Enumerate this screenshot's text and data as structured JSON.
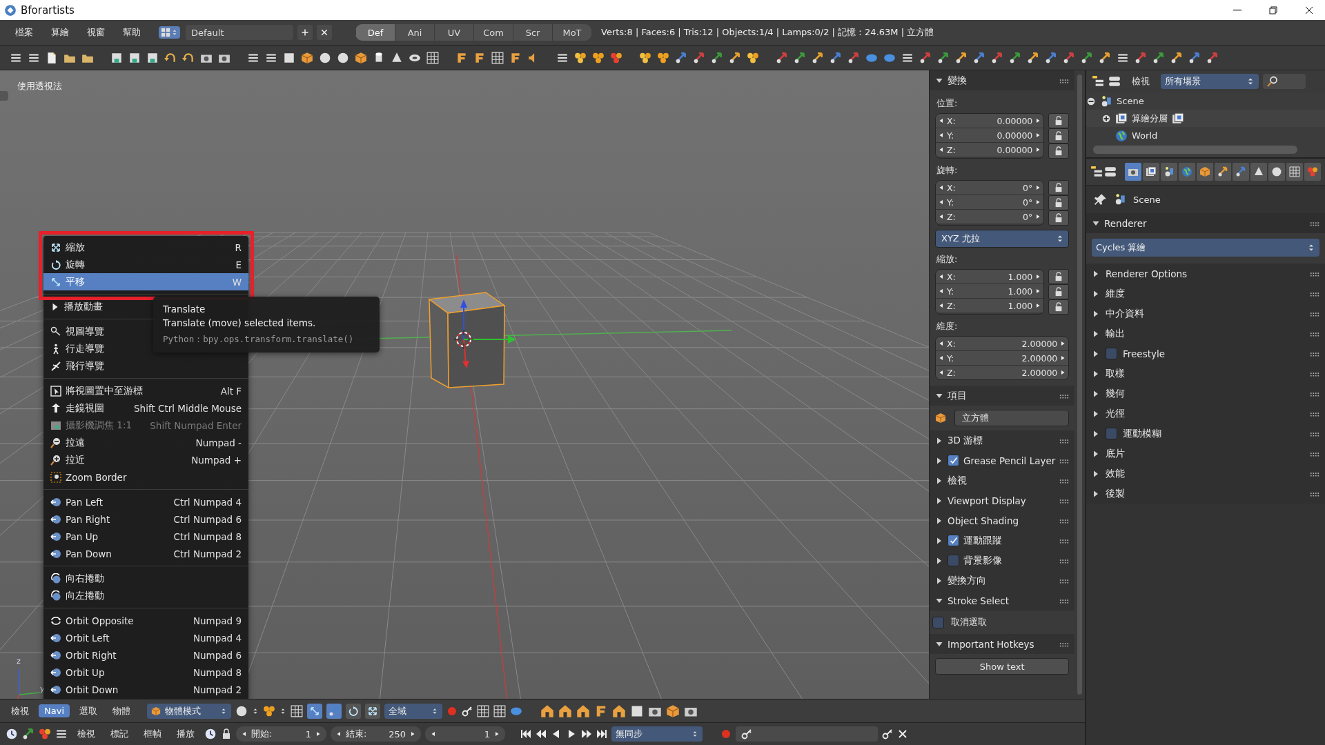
{
  "window": {
    "title": "Bforartists"
  },
  "menu_bar": [
    "檔案",
    "算繪",
    "視窗",
    "幫助"
  ],
  "layout": {
    "value": "Default"
  },
  "workspace_tabs": [
    {
      "label": "Def",
      "selected": true
    },
    {
      "label": "Ani",
      "selected": false
    },
    {
      "label": "UV",
      "selected": false
    },
    {
      "label": "Com",
      "selected": false
    },
    {
      "label": "Scr",
      "selected": false
    },
    {
      "label": "MoT",
      "selected": false
    }
  ],
  "stats": "Verts:8 | Faces:6 | Tris:12 | Objects:1/4 | Lamps:0/2 | 記憶：24.63M | 立方體",
  "viewport": {
    "label": "使用透視法",
    "axis_labels": [
      "z",
      "y"
    ]
  },
  "view_menu": {
    "sections": [
      [
        {
          "label": "縮放",
          "shortcut": "R",
          "kind": "command",
          "selected": false,
          "disabled": false
        },
        {
          "label": "旋轉",
          "shortcut": "E",
          "kind": "command",
          "selected": false,
          "disabled": false
        },
        {
          "label": "平移",
          "shortcut": "W",
          "kind": "command",
          "selected": true,
          "disabled": false
        }
      ],
      [
        {
          "label": "播放動畫",
          "kind": "submenu",
          "selected": false,
          "disabled": false
        }
      ],
      [
        {
          "label": "視圖導覽",
          "kind": "command",
          "selected": false,
          "disabled": false
        },
        {
          "label": "行走導覽",
          "kind": "command",
          "selected": false,
          "disabled": false
        },
        {
          "label": "飛行導覽",
          "kind": "command",
          "selected": false,
          "disabled": false
        }
      ],
      [
        {
          "label": "將視圖置中至游標",
          "shortcut": "Alt F",
          "kind": "command",
          "selected": false,
          "disabled": false
        },
        {
          "label": "走鏡視圖",
          "shortcut": "Shift Ctrl Middle Mouse",
          "kind": "command",
          "selected": false,
          "disabled": false
        },
        {
          "label": "攝影機調焦 1:1",
          "shortcut": "Shift Numpad Enter",
          "kind": "command",
          "selected": false,
          "disabled": true
        },
        {
          "label": "拉遠",
          "shortcut": "Numpad -",
          "kind": "command",
          "selected": false,
          "disabled": false
        },
        {
          "label": "拉近",
          "shortcut": "Numpad +",
          "kind": "command",
          "selected": false,
          "disabled": false
        },
        {
          "label": "Zoom Border",
          "kind": "command",
          "selected": false,
          "disabled": false
        }
      ],
      [
        {
          "label": "Pan Left",
          "shortcut": "Ctrl Numpad 4",
          "kind": "command",
          "selected": false,
          "disabled": false
        },
        {
          "label": "Pan Right",
          "shortcut": "Ctrl Numpad 6",
          "kind": "command",
          "selected": false,
          "disabled": false
        },
        {
          "label": "Pan Up",
          "shortcut": "Ctrl Numpad 8",
          "kind": "command",
          "selected": false,
          "disabled": false
        },
        {
          "label": "Pan Down",
          "shortcut": "Ctrl Numpad 2",
          "kind": "command",
          "selected": false,
          "disabled": false
        }
      ],
      [
        {
          "label": "向右捲動",
          "kind": "command",
          "selected": false,
          "disabled": false
        },
        {
          "label": "向左捲動",
          "kind": "command",
          "selected": false,
          "disabled": false
        }
      ],
      [
        {
          "label": "Orbit Opposite",
          "shortcut": "Numpad 9",
          "kind": "command",
          "selected": false,
          "disabled": false
        },
        {
          "label": "Orbit Left",
          "shortcut": "Numpad 4",
          "kind": "command",
          "selected": false,
          "disabled": false
        },
        {
          "label": "Orbit Right",
          "shortcut": "Numpad 6",
          "kind": "command",
          "selected": false,
          "disabled": false
        },
        {
          "label": "Orbit Up",
          "shortcut": "Numpad 8",
          "kind": "command",
          "selected": false,
          "disabled": false
        },
        {
          "label": "Orbit Down",
          "shortcut": "Numpad 2",
          "kind": "command",
          "selected": false,
          "disabled": false
        }
      ]
    ]
  },
  "tooltip": {
    "title": "Translate",
    "description": "Translate (move) selected items.",
    "python": "Python：bpy.ops.transform.translate()"
  },
  "n_panel": {
    "transform": {
      "title": "變換",
      "expanded": true,
      "rows": [
        {
          "kind": "vector",
          "label": "位置:",
          "locks": true,
          "fields": [
            {
              "axis": "X:",
              "value": "0.00000"
            },
            {
              "axis": "Y:",
              "value": "0.00000"
            },
            {
              "axis": "Z:",
              "value": "0.00000"
            }
          ]
        },
        {
          "kind": "vector",
          "label": "旋轉:",
          "locks": true,
          "fields": [
            {
              "axis": "X:",
              "value": "0°"
            },
            {
              "axis": "Y:",
              "value": "0°"
            },
            {
              "axis": "Z:",
              "value": "0°"
            }
          ]
        },
        {
          "kind": "dropdown",
          "value": "XYZ 尤拉"
        },
        {
          "kind": "vector",
          "label": "縮放:",
          "locks": true,
          "fields": [
            {
              "axis": "X:",
              "value": "1.000"
            },
            {
              "axis": "Y:",
              "value": "1.000"
            },
            {
              "axis": "Z:",
              "value": "1.000"
            }
          ]
        },
        {
          "kind": "vector",
          "label": "維度:",
          "locks": false,
          "fields": [
            {
              "axis": "X:",
              "value": "2.00000"
            },
            {
              "axis": "Y:",
              "value": "2.00000"
            },
            {
              "axis": "Z:",
              "value": "2.00000"
            }
          ]
        }
      ]
    },
    "item": {
      "title": "項目",
      "expanded": true,
      "name": "立方體"
    },
    "panels": [
      {
        "title": "3D 游標",
        "expanded": false,
        "kind": "plain"
      },
      {
        "title": "Grease Pencil Layer",
        "expanded": false,
        "kind": "toggle",
        "checked": true
      },
      {
        "title": "檢視",
        "expanded": false,
        "kind": "plain"
      },
      {
        "title": "Viewport Display",
        "expanded": false,
        "kind": "plain"
      },
      {
        "title": "Object Shading",
        "expanded": false,
        "kind": "plain"
      },
      {
        "title": "運動跟蹤",
        "expanded": false,
        "kind": "toggle",
        "checked": true
      },
      {
        "title": "背景影像",
        "expanded": false,
        "kind": "toggle",
        "checked": false
      },
      {
        "title": "變換方向",
        "expanded": false,
        "kind": "plain"
      },
      {
        "title": "Stroke Select",
        "expanded": true,
        "kind": "plain",
        "options": [
          {
            "label": "取消選取",
            "checked": false
          }
        ]
      },
      {
        "title": "Important Hotkeys",
        "expanded": true,
        "kind": "plain",
        "button": "Show text"
      }
    ]
  },
  "outliner": {
    "display_label": "檢視",
    "filter": "所有場景",
    "tree": [
      {
        "label": "Scene",
        "expanded": true,
        "children": [
          {
            "label": "算繪分層",
            "expanded": false
          },
          {
            "label": "World"
          }
        ]
      }
    ]
  },
  "properties": {
    "tabs": [
      {
        "selected": true
      },
      {
        "selected": false
      },
      {
        "selected": false
      },
      {
        "selected": false
      },
      {
        "selected": false
      },
      {
        "selected": false
      },
      {
        "selected": false
      },
      {
        "selected": false
      },
      {
        "selected": false
      },
      {
        "selected": false
      },
      {
        "selected": false
      }
    ],
    "breadcrumb": "Scene",
    "renderer": {
      "title": "Renderer",
      "expanded": true,
      "engine": "Cycles 算繪"
    },
    "panels": [
      {
        "title": "Renderer Options",
        "expanded": false,
        "kind": "plain"
      },
      {
        "title": "維度",
        "expanded": false,
        "kind": "plain"
      },
      {
        "title": "中介資料",
        "expanded": false,
        "kind": "plain"
      },
      {
        "title": "輸出",
        "expanded": false,
        "kind": "plain"
      },
      {
        "title": "Freestyle",
        "expanded": false,
        "kind": "toggle",
        "checked": false
      },
      {
        "title": "取樣",
        "expanded": false,
        "kind": "plain"
      },
      {
        "title": "幾何",
        "expanded": false,
        "kind": "plain"
      },
      {
        "title": "光徑",
        "expanded": false,
        "kind": "plain"
      },
      {
        "title": "運動模糊",
        "expanded": false,
        "kind": "toggle",
        "checked": false
      },
      {
        "title": "底片",
        "expanded": false,
        "kind": "plain"
      },
      {
        "title": "效能",
        "expanded": false,
        "kind": "plain"
      },
      {
        "title": "後製",
        "expanded": false,
        "kind": "plain"
      }
    ]
  },
  "view3d_header": {
    "menus": [
      {
        "label": "檢視",
        "selected": false
      },
      {
        "label": "Navi",
        "selected": true
      },
      {
        "label": "選取",
        "selected": false
      },
      {
        "label": "物體",
        "selected": false
      }
    ],
    "mode": "物體模式",
    "orientation": "全域"
  },
  "timeline": {
    "menus": [
      "檢視",
      "標記",
      "框幀",
      "播放"
    ],
    "start": {
      "label": "開始:",
      "value": "1"
    },
    "end": {
      "label": "結束:",
      "value": "250"
    },
    "current": "1",
    "sync": "無同步"
  }
}
